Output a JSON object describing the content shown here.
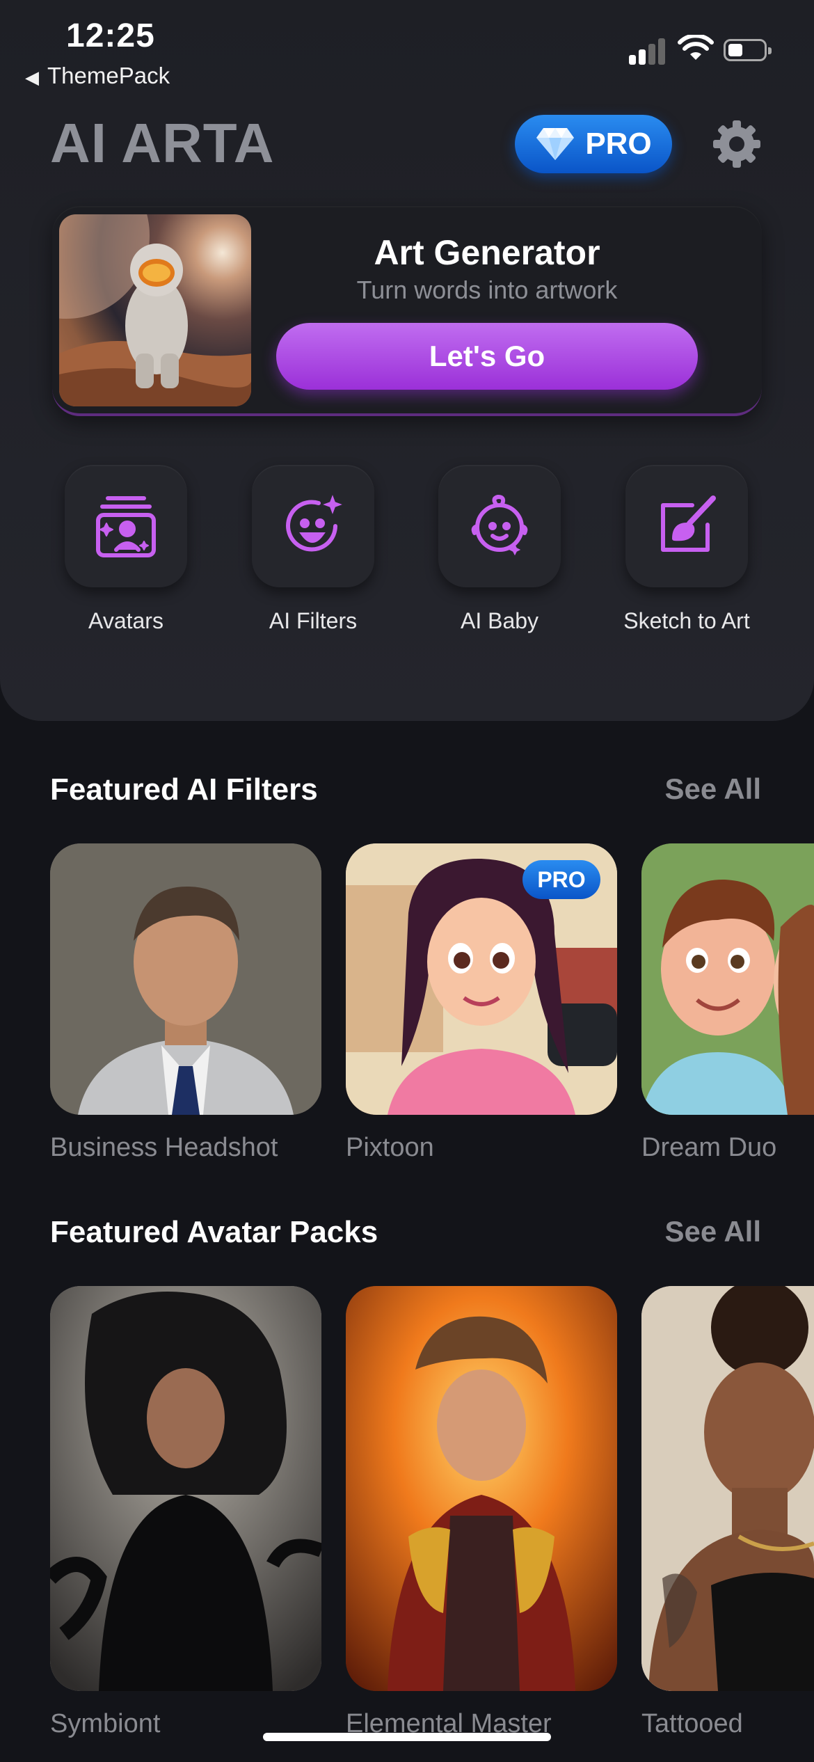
{
  "status": {
    "time": "12:25",
    "back_label": "ThemePack"
  },
  "header": {
    "title": "AI ARTA",
    "pro_label": "PRO"
  },
  "art_card": {
    "title": "Art Generator",
    "subtitle": "Turn words into artwork",
    "button": "Let's Go"
  },
  "features": [
    {
      "label": "Avatars",
      "icon": "avatars-icon"
    },
    {
      "label": "AI Filters",
      "icon": "ai-filters-icon"
    },
    {
      "label": "AI Baby",
      "icon": "ai-baby-icon"
    },
    {
      "label": "Sketch to Art",
      "icon": "sketch-to-art-icon"
    }
  ],
  "filters": {
    "title": "Featured AI Filters",
    "see_all": "See All",
    "items": [
      {
        "label": "Business Headshot"
      },
      {
        "label": "Pixtoon",
        "badge": "PRO"
      },
      {
        "label": "Dream Duo"
      }
    ]
  },
  "avatar_packs": {
    "title": "Featured Avatar Packs",
    "see_all": "See All",
    "items": [
      {
        "label": "Symbiont"
      },
      {
        "label": "Elemental Master"
      },
      {
        "label": "Tattooed"
      }
    ]
  },
  "colors": {
    "accent_purple": "#b04ee6",
    "pro_blue": "#1670e0",
    "background": "#131419"
  }
}
